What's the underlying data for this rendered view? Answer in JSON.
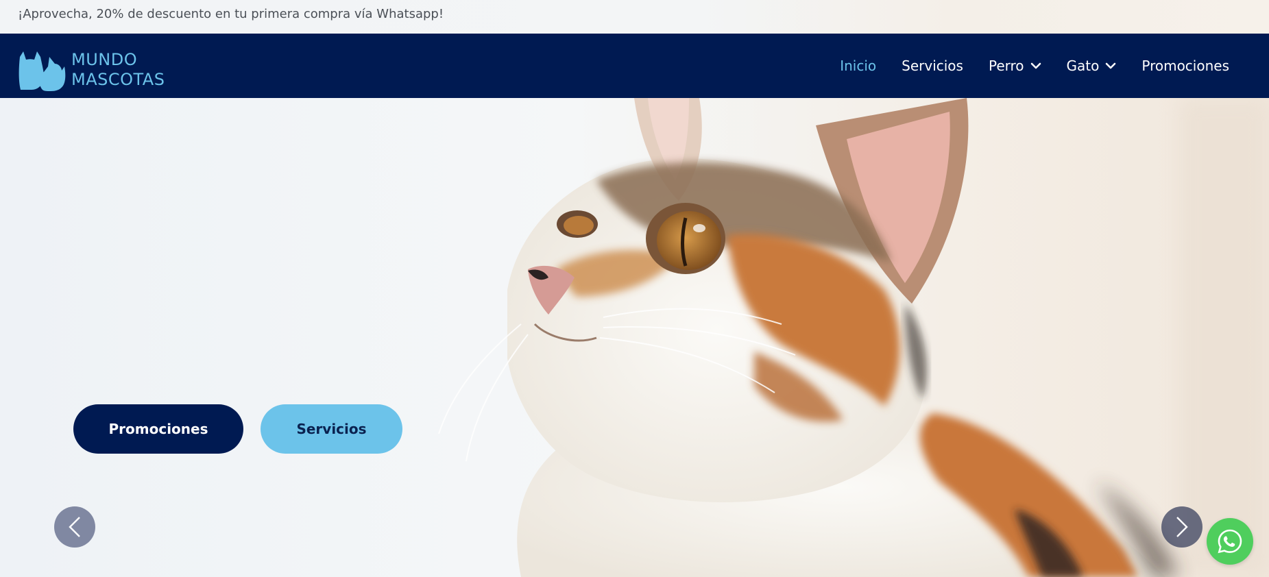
{
  "announcement": {
    "text": "¡Aprovecha, 20% de descuento en tu primera compra vía Whatsapp!"
  },
  "brand": {
    "line1": "MUNDO",
    "line2": "MASCOTAS",
    "logo_icon": "pets-silhouette-icon"
  },
  "nav": {
    "items": [
      {
        "label": "Inicio",
        "active": true,
        "dropdown": false
      },
      {
        "label": "Servicios",
        "active": false,
        "dropdown": false
      },
      {
        "label": "Perro",
        "active": false,
        "dropdown": true
      },
      {
        "label": "Gato",
        "active": false,
        "dropdown": true
      },
      {
        "label": "Promociones",
        "active": false,
        "dropdown": false
      }
    ]
  },
  "hero": {
    "primary_button": "Promociones",
    "secondary_button": "Servicios",
    "prev_icon": "chevron-left-icon",
    "next_icon": "chevron-right-icon",
    "image": "calico-cat-photo"
  },
  "floating": {
    "icon": "whatsapp-icon"
  },
  "colors": {
    "navy": "#001a52",
    "accent": "#6cc3ea",
    "whatsapp": "#4fce5d"
  }
}
